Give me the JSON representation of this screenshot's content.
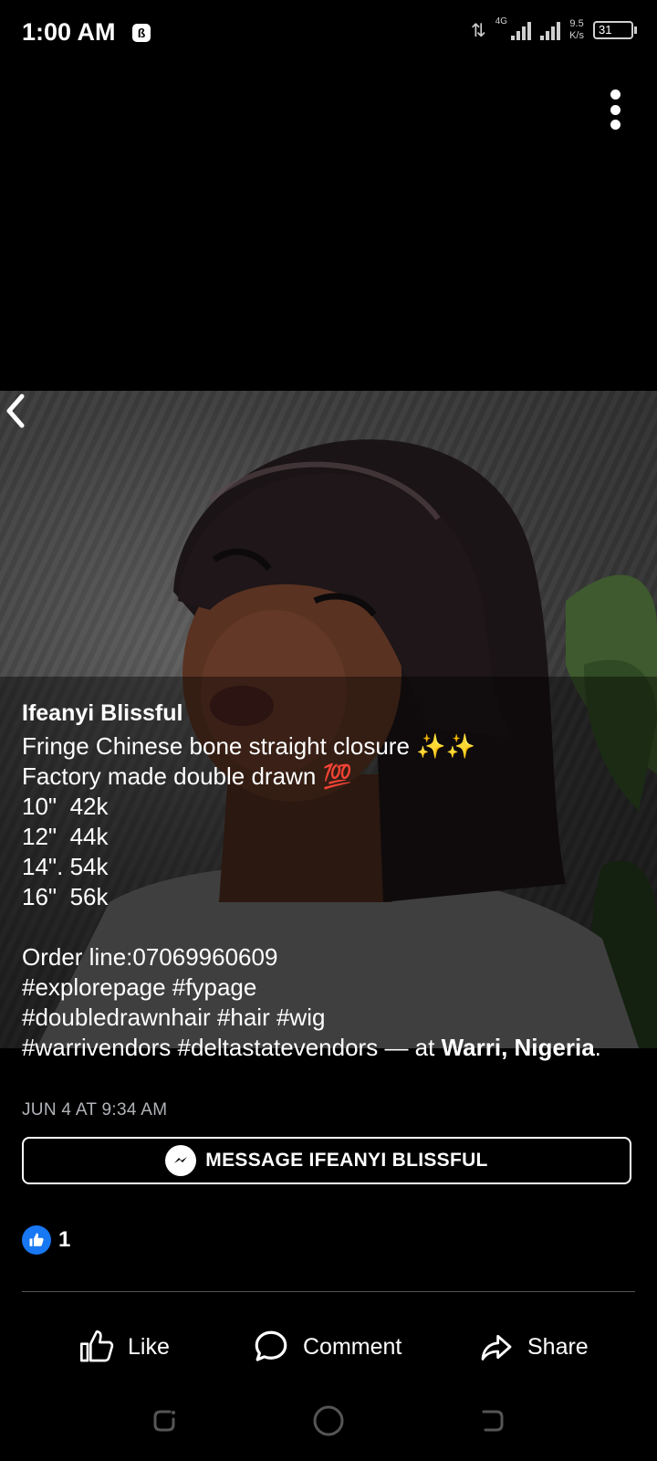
{
  "status_bar": {
    "time": "1:00 AM",
    "app_icon_glyph": "ß",
    "network": "4G",
    "speed_value": "9.5",
    "speed_unit": "K/s",
    "battery": "31"
  },
  "post": {
    "author": "Ifeanyi Blissful",
    "caption_lines": [
      "Fringe Chinese bone straight closure ✨✨",
      "Factory made double drawn 💯",
      "10\"  42k",
      "12\"  44k",
      "14\". 54k",
      "16\"  56k",
      "",
      "Order line:07069960609",
      "#explorepage #fypage",
      "#doubledrawnhair #hair #wig"
    ],
    "last_line_prefix": "#warrivendors #deltastatevendors — at ",
    "location": "Warri, Nigeria",
    "last_line_suffix": ".",
    "timestamp": "JUN 4 AT 9:34 AM",
    "message_button_label": "MESSAGE IFEANYI BLISSFUL",
    "reaction_count": "1"
  },
  "actions": {
    "like": "Like",
    "comment": "Comment",
    "share": "Share"
  },
  "colors": {
    "background": "#000000",
    "text": "#ffffff",
    "muted": "#b0b3b8",
    "like_blue": "#1877f2"
  },
  "icons": [
    "more-vertical-icon",
    "back-chevron-icon",
    "messenger-icon",
    "like-reaction-icon",
    "thumbs-up-icon",
    "comment-icon",
    "share-icon",
    "recent-apps-icon",
    "home-icon",
    "back-nav-icon"
  ]
}
